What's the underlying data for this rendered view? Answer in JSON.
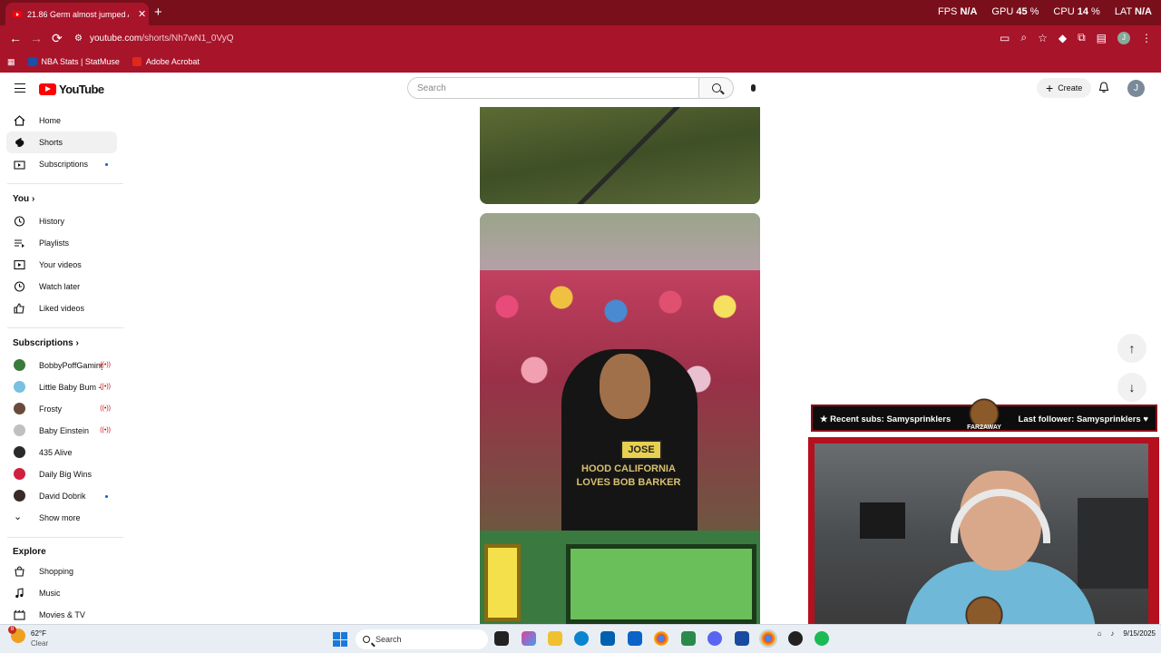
{
  "browser": {
    "tab_title": "21.86 Germ almost jumped A n",
    "tab_close": "✕",
    "new_tab": "+",
    "url_host": "youtube.com",
    "url_path": "/shorts/Nh7wN1_0VyQ",
    "bookmarks": [
      {
        "label": "NBA Stats | StatMuse",
        "color": "#1b4fa8"
      },
      {
        "label": "Adobe Acrobat",
        "color": "#e0281c"
      }
    ],
    "stats": {
      "fps_label": "FPS",
      "fps_value": "N/A",
      "gpu_label": "GPU",
      "gpu_value": "45",
      "cpu_label": "CPU",
      "cpu_value": "14",
      "lat_label": "LAT",
      "lat_value": "N/A"
    },
    "profile_initial": "J"
  },
  "header": {
    "logo_text": "YouTube",
    "search_placeholder": "Search",
    "create_label": "Create",
    "avatar_initial": "J"
  },
  "sidebar": {
    "main": [
      {
        "label": "Home",
        "icon": "home-icon"
      },
      {
        "label": "Shorts",
        "icon": "shorts-icon",
        "active": true
      },
      {
        "label": "Subscriptions",
        "icon": "subscriptions-icon",
        "dot": true
      }
    ],
    "you_heading": "You",
    "you_items": [
      {
        "label": "History",
        "icon": "history-icon"
      },
      {
        "label": "Playlists",
        "icon": "playlists-icon"
      },
      {
        "label": "Your videos",
        "icon": "your-videos-icon"
      },
      {
        "label": "Watch later",
        "icon": "watch-later-icon"
      },
      {
        "label": "Liked videos",
        "icon": "liked-videos-icon"
      }
    ],
    "subs_heading": "Subscriptions",
    "subs": [
      {
        "label": "BobbyPoffGaming",
        "live": true,
        "color": "#3a7a3a"
      },
      {
        "label": "Little Baby Bum -...",
        "live": true,
        "color": "#7ac0e0"
      },
      {
        "label": "Frosty",
        "live": true,
        "color": "#6a4a3a"
      },
      {
        "label": "Baby Einstein",
        "live": true,
        "color": "#c0c0c0"
      },
      {
        "label": "435 Alive",
        "live": false,
        "color": "#2a2a2a"
      },
      {
        "label": "Daily Big Wins",
        "live": false,
        "color": "#d02040"
      },
      {
        "label": "David Dobrik",
        "live": false,
        "dot": true,
        "color": "#3a2a2a"
      }
    ],
    "show_more": "Show more",
    "explore_heading": "Explore",
    "explore_items": [
      {
        "label": "Shopping",
        "icon": "shopping-icon"
      },
      {
        "label": "Music",
        "icon": "music-icon"
      },
      {
        "label": "Movies & TV",
        "icon": "movies-icon"
      }
    ]
  },
  "video": {
    "shirt_text": "HOOD CALIFORNIA LOVES BOB BARKER",
    "name_tag": "JOSE"
  },
  "overlay": {
    "recent_subs": "Recent subs: Samysprinklers",
    "last_follower": "Last follower: Samysprinklers",
    "brand": "FAR2AWAY"
  },
  "taskbar": {
    "weather_temp": "62°F",
    "weather_desc": "Clear",
    "weather_badge": "8",
    "search_label": "Search",
    "date": "9/15/2025"
  }
}
